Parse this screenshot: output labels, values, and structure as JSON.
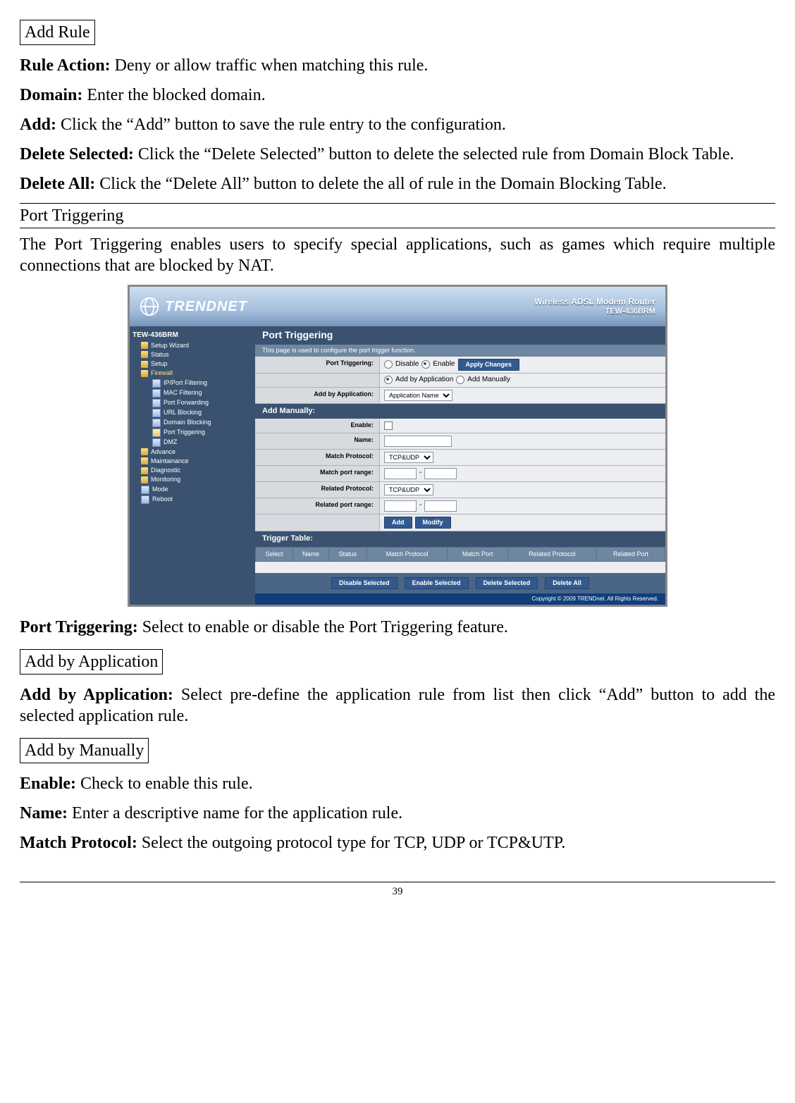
{
  "sections": {
    "add_rule_heading": "Add Rule",
    "rule_action_label": "Rule Action:",
    "rule_action_text": " Deny or allow traffic when matching this rule.",
    "domain_label": "Domain:",
    "domain_text": " Enter the blocked domain.",
    "add_label": "Add:",
    "add_text": " Click the “Add” button to save the rule entry to the configuration.",
    "delete_selected_label": "Delete Selected:",
    "delete_selected_text": " Click the “Delete Selected” button to delete the selected rule from Domain Block Table.",
    "delete_all_label": "Delete All:",
    "delete_all_text": " Click the “Delete All” button to delete the all of rule in the Domain Blocking Table.",
    "port_triggering_heading": "Port Triggering",
    "port_triggering_intro": "The Port Triggering enables users to specify special applications, such as games which require multiple connections that are blocked by NAT.",
    "port_triggering_label": "Port Triggering:",
    "port_triggering_text": " Select to enable or disable the Port Triggering feature.",
    "add_by_app_heading": "Add by Application",
    "add_by_app_label": "Add by Application:",
    "add_by_app_text": " Select pre-define the application rule from list then click “Add” button to add the selected application rule.",
    "add_manually_heading": "Add by Manually",
    "enable_label": "Enable:",
    "enable_text": " Check to enable this rule.",
    "name_label": "Name:",
    "name_text": " Enter a descriptive name for the application rule.",
    "match_protocol_label": "Match Protocol:",
    "match_protocol_text": " Select the outgoing protocol type for TCP, UDP or TCP&UTP.",
    "page_number": "39"
  },
  "router_ui": {
    "brand": "TRENDNET",
    "header_title": "Wireless ADSL Modem Router",
    "header_model": "TEW-436BRM",
    "copyright": "Copyright © 2009 TRENDnet. All Rights Reserved.",
    "sidebar": {
      "root": "TEW-436BRM",
      "items_l1": [
        {
          "icon": "folder",
          "label": "Setup Wizard"
        },
        {
          "icon": "folder",
          "label": "Status"
        },
        {
          "icon": "folder",
          "label": "Setup"
        },
        {
          "icon": "folder",
          "label": "Firewall",
          "open": true
        },
        {
          "icon": "folder",
          "label": "Advance"
        },
        {
          "icon": "folder",
          "label": "Maintainance"
        },
        {
          "icon": "folder",
          "label": "Diagnostic"
        },
        {
          "icon": "folder",
          "label": "Monitoring"
        },
        {
          "icon": "page",
          "label": "Mode"
        },
        {
          "icon": "page",
          "label": "Reboot"
        }
      ],
      "firewall_children": [
        "IP/Port Filtering",
        "MAC Filtering",
        "Port Forwarding",
        "URL Blocking",
        "Domain Blocking",
        "Port Triggering",
        "DMZ"
      ]
    },
    "content": {
      "panel_title": "Port Triggering",
      "panel_subtitle": "This page is used to configure the port trigger function.",
      "rows": {
        "port_triggering_label": "Port Triggering:",
        "disable": "Disable",
        "enable": "Enable",
        "apply_changes": "Apply Changes",
        "add_mode_app": "Add by Application",
        "add_mode_manual": "Add Manually",
        "add_by_application_label": "Add by Application:",
        "application_name_option": "Application Name",
        "add_manually_heading": "Add Manually:",
        "enable_label": "Enable:",
        "name_label": "Name:",
        "match_protocol_label": "Match Protocol:",
        "match_port_range_label": "Match port range:",
        "related_protocol_label": "Related Protocol:",
        "related_port_range_label": "Related port range:",
        "protocol_option": "TCP&UDP",
        "dash": "-",
        "btn_add": "Add",
        "btn_modify": "Modify"
      },
      "trigger_table": {
        "heading": "Trigger Table:",
        "cols": [
          "Select",
          "Name",
          "Status",
          "Match Protocol",
          "Match Port",
          "Related Protocol",
          "Related Port"
        ]
      },
      "actions": {
        "disable_selected": "Disable Selected",
        "enable_selected": "Enable Selected",
        "delete_selected": "Delete Selected",
        "delete_all": "Delete All"
      }
    }
  }
}
